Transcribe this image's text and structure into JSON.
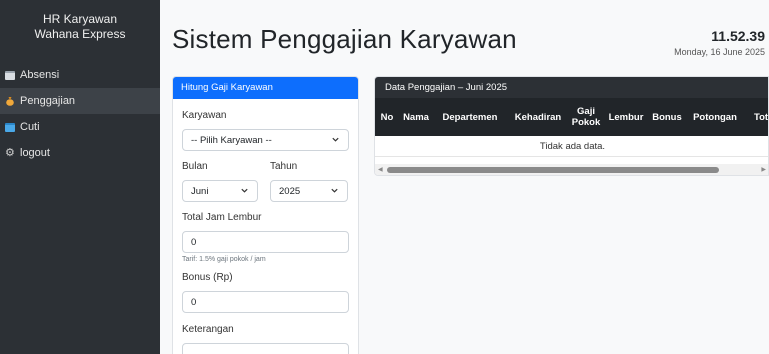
{
  "sidebar": {
    "brand_line1": "HR Karyawan",
    "brand_line2": "Wahana Express",
    "items": [
      {
        "label": "Absensi",
        "icon": "calendar-icon"
      },
      {
        "label": "Penggajian",
        "icon": "money-bag-icon",
        "active": true
      },
      {
        "label": "Cuti",
        "icon": "calendar-icon"
      },
      {
        "label": "logout",
        "icon": "gear-icon"
      }
    ]
  },
  "header": {
    "title": "Sistem Penggajian Karyawan",
    "time": "11.52.39",
    "date": "Monday, 16 June 2025"
  },
  "form": {
    "header": "Hitung Gaji Karyawan",
    "karyawan_label": "Karyawan",
    "karyawan_value": "-- Pilih Karyawan --",
    "bulan_label": "Bulan",
    "bulan_value": "Juni",
    "tahun_label": "Tahun",
    "tahun_value": "2025",
    "lembur_label": "Total Jam Lembur",
    "lembur_value": "0",
    "lembur_hint": "Tarif: 1.5% gaji pokok / jam",
    "bonus_label": "Bonus (Rp)",
    "bonus_value": "0",
    "keterangan_label": "Keterangan"
  },
  "table": {
    "title": "Data Penggajian – Juni 2025",
    "columns": [
      "No",
      "Nama",
      "Departemen",
      "Kehadiran",
      "Gaji Pokok",
      "Lembur",
      "Bonus",
      "Potongan",
      "Total"
    ],
    "empty_text": "Tidak ada data."
  },
  "colors": {
    "sidebar_bg": "#2c3035",
    "accent": "#0d6efd",
    "table_header_bg": "#212529"
  }
}
